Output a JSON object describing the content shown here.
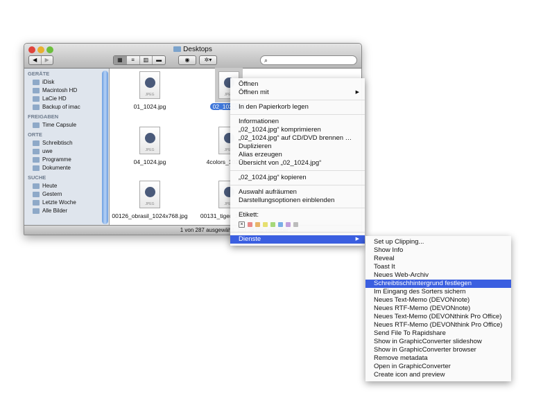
{
  "window": {
    "title": "Desktops",
    "search_placeholder": "",
    "status": "1 von 287 ausgewählt, 163,28 GB verfügbar"
  },
  "sidebar": {
    "sections": [
      {
        "title": "GERÄTE",
        "items": [
          "iDisk",
          "Macintosh HD",
          "LaCie HD",
          "Backup of imac"
        ]
      },
      {
        "title": "FREIGABEN",
        "items": [
          "Time Capsule"
        ]
      },
      {
        "title": "ORTE",
        "items": [
          "Schreibtisch",
          "uwe",
          "Programme",
          "Dokumente"
        ]
      },
      {
        "title": "SUCHE",
        "items": [
          "Heute",
          "Gestern",
          "Letzte Woche",
          "Alle Bilder"
        ]
      }
    ]
  },
  "files": [
    "01_1024.jpg",
    "02_1024.jpg",
    "04_1024.jpg",
    "4colors_1024.jpg",
    "00126_obrasil_1024x768.jpg",
    "00131_tiger_1024.jpg"
  ],
  "context_menu": {
    "groups": [
      [
        "Öffnen",
        "Öffnen mit"
      ],
      [
        "In den Papierkorb legen"
      ],
      [
        "Informationen",
        "„02_1024.jpg“ komprimieren",
        "„02_1024.jpg“ auf CD/DVD brennen …",
        "Duplizieren",
        "Alias erzeugen",
        "Übersicht von „02_1024.jpg“"
      ],
      [
        "„02_1024.jpg“ kopieren"
      ],
      [
        "Auswahl aufräumen",
        "Darstellungsoptionen einblenden"
      ]
    ],
    "label_title": "Etikett:",
    "label_colors": [
      "#e88a8a",
      "#e8b46a",
      "#e6e070",
      "#a6d87a",
      "#7aaee6",
      "#c2a0dc",
      "#bcbcbc"
    ],
    "services": "Dienste"
  },
  "services_menu": [
    "Set up Clipping...",
    "Show Info",
    "Reveal",
    "Toast It",
    "Neues Web-Archiv",
    "Schreibtischhintergrund festlegen",
    "Im Eingang des Sorters sichern",
    "Neues Text-Memo (DEVONnote)",
    "Neues RTF-Memo (DEVONnote)",
    "Neues Text-Memo (DEVONthink Pro Office)",
    "Neues RTF-Memo (DEVONthink Pro Office)",
    "Send File To Rapidshare",
    "Show in GraphicConverter slideshow",
    "Show in GraphicConverter browser",
    "Remove metadata",
    "Open in GraphicConverter",
    "Create icon and preview"
  ],
  "services_highlighted": 5
}
